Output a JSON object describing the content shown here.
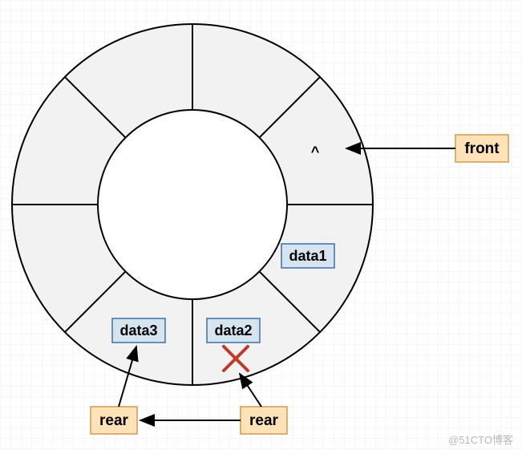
{
  "diagram": {
    "segments": 8,
    "empty_marker": "^",
    "cells": {
      "data1_label": "data1",
      "data2_label": "data2",
      "data3_label": "data3"
    },
    "pointers": {
      "front_label": "front",
      "rear_right_label": "rear",
      "rear_left_label": "rear"
    },
    "watermark": "@51CTO博客",
    "colors": {
      "ring_fill": "#f2f2f2",
      "ring_stroke": "#000000",
      "cell_fill": "#d6e4f0",
      "cell_stroke": "#3d6fa5",
      "pointer_fill": "#ffe2b8",
      "pointer_stroke": "#d09a4e",
      "cross": "#c0392b",
      "grid": "#e9eef2"
    }
  }
}
